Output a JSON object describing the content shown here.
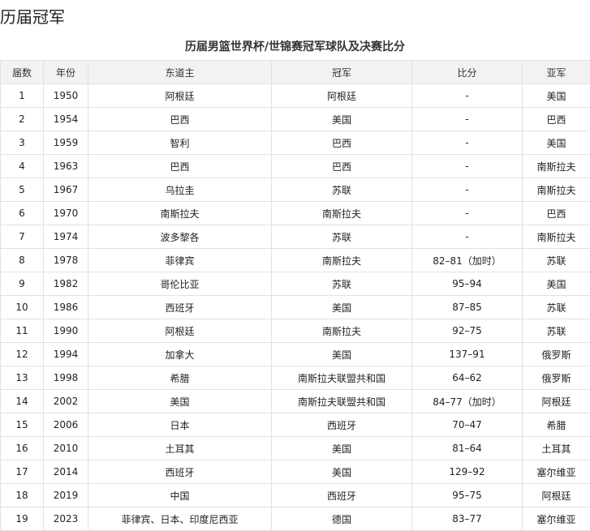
{
  "section_title": "历届冠军",
  "table": {
    "caption": "历届男篮世界杯/世锦赛冠军球队及决赛比分",
    "headers": [
      "届数",
      "年份",
      "东道主",
      "冠军",
      "比分",
      "亚军"
    ],
    "rows": [
      [
        "1",
        "1950",
        "阿根廷",
        "阿根廷",
        "-",
        "美国"
      ],
      [
        "2",
        "1954",
        "巴西",
        "美国",
        "-",
        "巴西"
      ],
      [
        "3",
        "1959",
        "智利",
        "巴西",
        "-",
        "美国"
      ],
      [
        "4",
        "1963",
        "巴西",
        "巴西",
        "-",
        "南斯拉夫"
      ],
      [
        "5",
        "1967",
        "乌拉圭",
        "苏联",
        "-",
        "南斯拉夫"
      ],
      [
        "6",
        "1970",
        "南斯拉夫",
        "南斯拉夫",
        "-",
        "巴西"
      ],
      [
        "7",
        "1974",
        "波多黎各",
        "苏联",
        "-",
        "南斯拉夫"
      ],
      [
        "8",
        "1978",
        "菲律宾",
        "南斯拉夫",
        "82–81（加时）",
        "苏联"
      ],
      [
        "9",
        "1982",
        "哥伦比亚",
        "苏联",
        "95–94",
        "美国"
      ],
      [
        "10",
        "1986",
        "西班牙",
        "美国",
        "87–85",
        "苏联"
      ],
      [
        "11",
        "1990",
        "阿根廷",
        "南斯拉夫",
        "92–75",
        "苏联"
      ],
      [
        "12",
        "1994",
        "加拿大",
        "美国",
        "137–91",
        "俄罗斯"
      ],
      [
        "13",
        "1998",
        "希腊",
        "南斯拉夫联盟共和国",
        "64–62",
        "俄罗斯"
      ],
      [
        "14",
        "2002",
        "美国",
        "南斯拉夫联盟共和国",
        "84–77（加时）",
        "阿根廷"
      ],
      [
        "15",
        "2006",
        "日本",
        "西班牙",
        "70–47",
        "希腊"
      ],
      [
        "16",
        "2010",
        "土耳其",
        "美国",
        "81–64",
        "土耳其"
      ],
      [
        "17",
        "2014",
        "西班牙",
        "美国",
        "129–92",
        "塞尔维亚"
      ],
      [
        "18",
        "2019",
        "中国",
        "西班牙",
        "95–75",
        "阿根廷"
      ],
      [
        "19",
        "2023",
        "菲律宾、日本、印度尼西亚",
        "德国",
        "83–77",
        "塞尔维亚"
      ]
    ]
  }
}
